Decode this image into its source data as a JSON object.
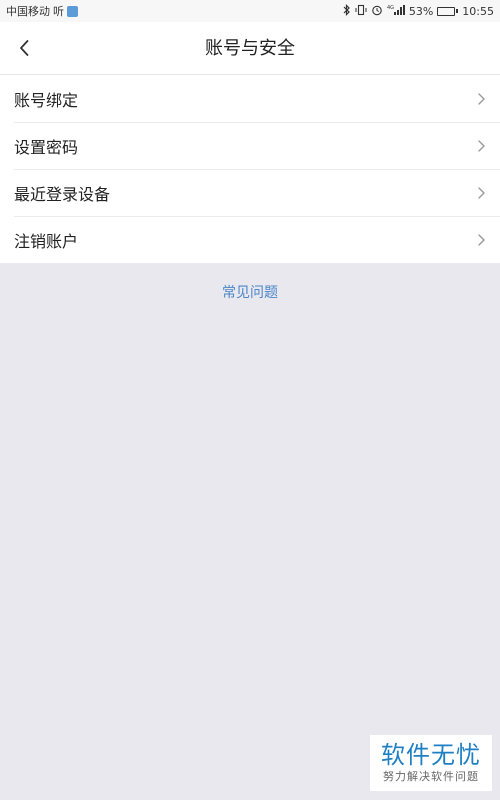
{
  "status_bar": {
    "carrier": "中国移动",
    "carrier_suffix": "听",
    "icons": [
      "bluetooth-icon",
      "vibrate-icon",
      "alarm-icon",
      "signal-icon"
    ],
    "signal_label": "4G",
    "battery_percent": "53%",
    "battery_level": 0.53,
    "battery_color": "#3cb44b",
    "time": "10:55"
  },
  "header": {
    "title": "账号与安全",
    "back_icon": "chevron-left-icon"
  },
  "settings": {
    "items": [
      {
        "label": "账号绑定"
      },
      {
        "label": "设置密码"
      },
      {
        "label": "最近登录设备"
      },
      {
        "label": "注销账户"
      }
    ]
  },
  "faq": {
    "label": "常见问题",
    "color": "#4a86c8"
  },
  "watermark": {
    "main": "软件无忧",
    "sub": "努力解决软件问题"
  }
}
